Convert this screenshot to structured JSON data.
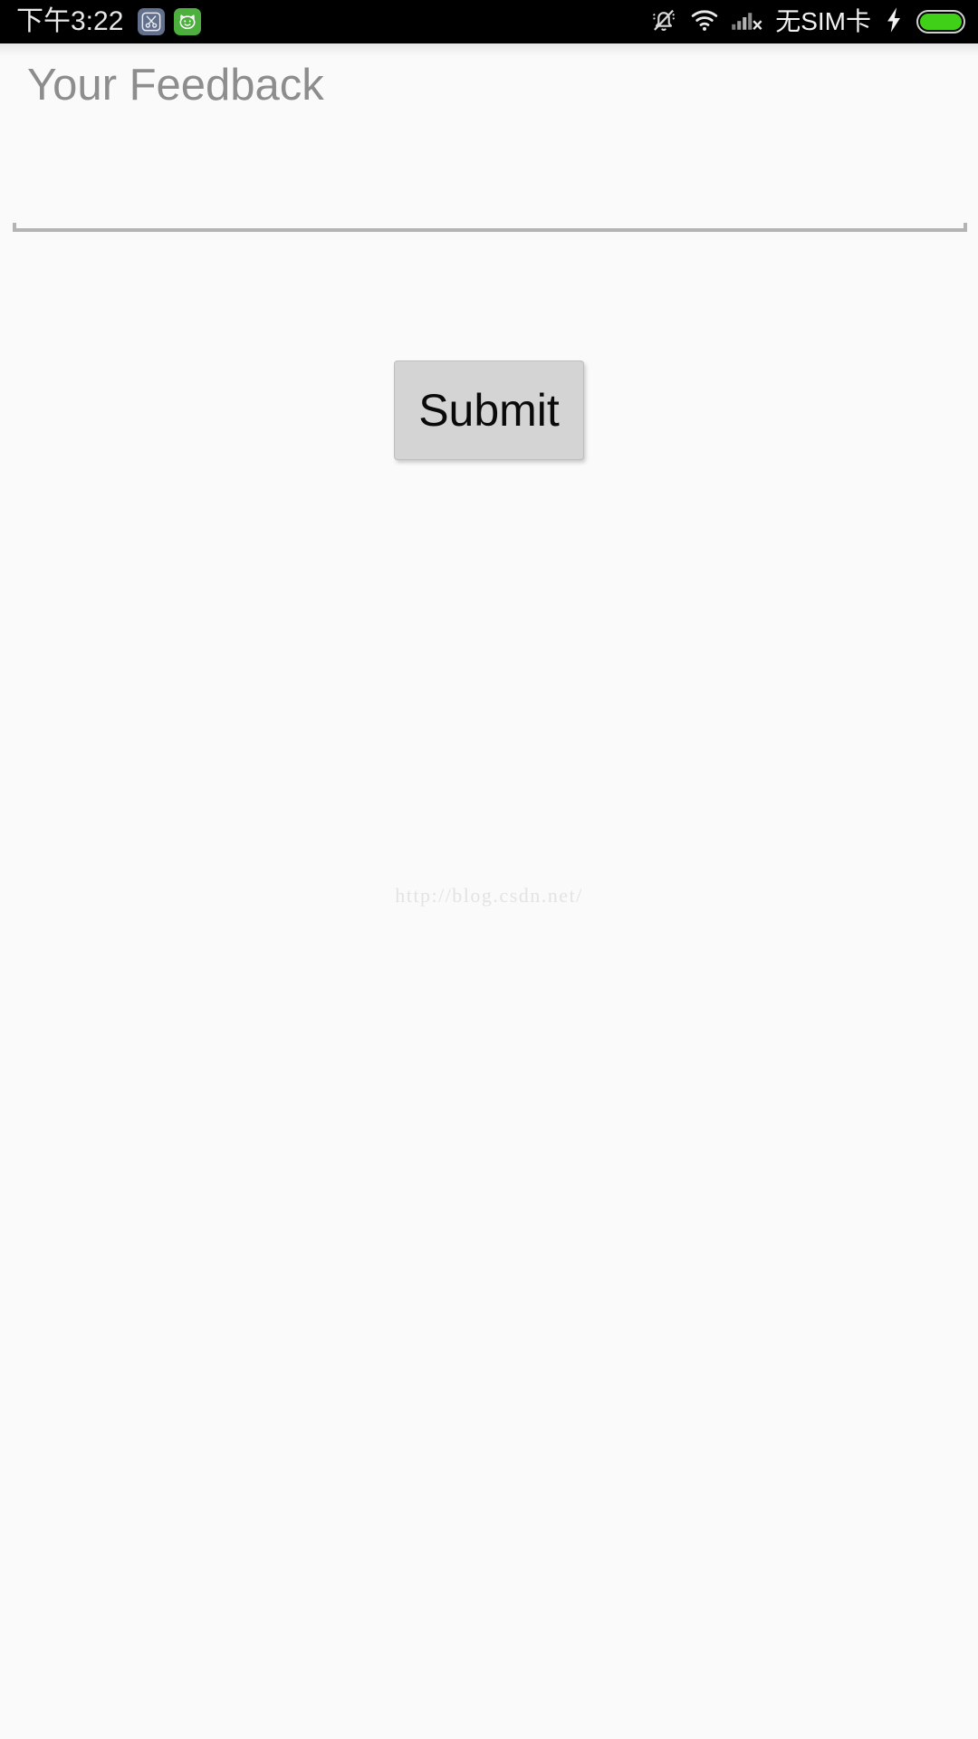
{
  "status_bar": {
    "clock": "下午3:22",
    "notification_icons": [
      {
        "name": "scissors-screenshot-icon",
        "glyph": "✂",
        "color": "#63708c"
      },
      {
        "name": "cat-face-icon",
        "glyph": "🐱",
        "color": "#4caf3e"
      }
    ],
    "silent_icon": "bell-muted-icon",
    "wifi_icon": "wifi-icon",
    "signal_icon": "signal-no-service-icon",
    "sim_text": "无SIM卡",
    "charging_icon": "charging-bolt-icon",
    "charging_glyph": "⚡",
    "battery_icon": "battery-full-icon",
    "battery_level_percent": 100,
    "battery_color": "#3fd017",
    "background_color": "#000000",
    "text_color": "#e8e8e8"
  },
  "screen": {
    "background_color": "#fafafa"
  },
  "feedback_input": {
    "name": "feedback-input",
    "value": "",
    "placeholder": "Your Feedback",
    "placeholder_color": "#8d8d8d",
    "underline_color": "#b4b4b4"
  },
  "submit_button": {
    "label": "Submit",
    "background_color": "#d4d4d4",
    "text_color": "#0a0a0a",
    "border_color": "#bdbdbd"
  },
  "watermark": {
    "text": "http://blog.csdn.net/",
    "color": "#e3e3e3"
  }
}
